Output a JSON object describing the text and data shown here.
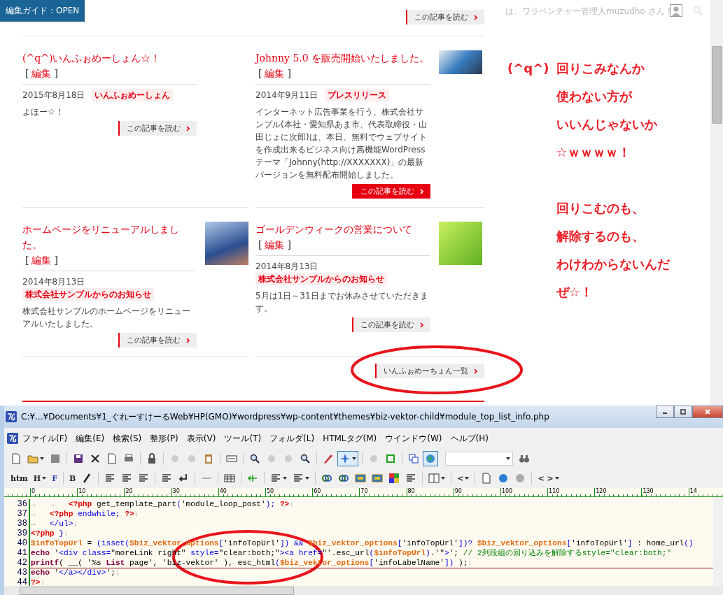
{
  "guide_tab": "編集ガイド：OPEN",
  "greeting": "は、ワラベンチャー管理人muzudho さん！",
  "top_read_more": {
    "label": "この記事を読む",
    "highlighted": false
  },
  "articles": [
    {
      "title": "(^q^)いんふぉめーしょん☆！",
      "edit": {
        "open": "[",
        "label": "編集",
        "close": "]"
      },
      "date": "2015年8月18日",
      "category": "いんふぉめーしょん",
      "excerpt": "よほー☆！",
      "read_more": {
        "label": "この記事を読む",
        "highlighted": false
      }
    },
    {
      "title": "Johnny 5.0 を販売開始いたしました。",
      "edit": {
        "open": "[",
        "label": "編集",
        "close": "]"
      },
      "date": "2014年9月11日",
      "category": "プレスリリース",
      "excerpt": "インターネット広告事業を行う、株式会社サンプル(本社・愛知県あま市、代表取締役・山田じょに次郎)は、本日、無料でウェブサイトを作成出来るビジネス向け高機能WordPressテーマ「Johnny(http://XXXXXXX)」の最新バージョンを無料配布開始しました。",
      "photo": {
        "kind": "laptop"
      },
      "read_more": {
        "label": "この記事を読む",
        "highlighted": true
      }
    },
    {
      "title": "ホームページをリニューアルしました。",
      "edit": {
        "open": "[",
        "label": "編集",
        "close": "]"
      },
      "date": "2014年8月13日",
      "category": "株式会社サンプルからのお知らせ",
      "excerpt": "株式会社サンプルのホームページをリニューアルいたしました。",
      "photo": {
        "kind": "hand"
      },
      "read_more": {
        "label": "この記事を読む",
        "highlighted": false
      }
    },
    {
      "title": "ゴールデンウィークの営業について",
      "edit": {
        "open": "[",
        "label": "編集",
        "close": "]"
      },
      "date": "2014年8月13日",
      "category": "株式会社サンプルからのお知らせ",
      "excerpt": "5月は1日～31日までお休みさせていただきます。",
      "photo": {
        "kind": "leaves"
      },
      "read_more": {
        "label": "この記事を読む",
        "highlighted": false
      }
    }
  ],
  "list_link": "いんふぉめーちょん一覧",
  "annotation": {
    "prefix": "(^q^)",
    "paragraphs": [
      [
        "回りこみなんか",
        "使わない方が",
        "いいんじゃないか",
        "☆ｗｗｗｗ！"
      ],
      [
        "回りこむのも、",
        "解除するのも、",
        "わけわからないんだ",
        "ぜ☆！"
      ]
    ]
  },
  "editor": {
    "title": "C:¥...¥Documents¥1_ぐれーすけーるWeb¥HP(GMO)¥wordpress¥wp-content¥themes¥biz-vektor-child¥module_top_list_info.php",
    "menu": [
      "ファイル(F)",
      "編集(E)",
      "検索(S)",
      "整形(P)",
      "表示(V)",
      "ツール(T)",
      "フォルダ(L)",
      "HTMLタグ(M)",
      "ウインドウ(W)",
      "ヘルプ(H)"
    ],
    "main_toolbar": [
      {
        "pressed": false
      },
      {
        "pressed": false
      },
      {
        "pressed": false
      },
      {
        "pressed": false
      },
      {
        "pressed": false
      },
      {
        "pressed": false
      },
      {
        "pressed": false
      },
      {
        "pressed": false
      },
      {
        "pressed": false
      },
      {
        "pressed": false
      },
      {
        "pressed": false
      },
      {
        "pressed": false
      },
      {
        "pressed": false
      },
      {
        "pressed": false
      },
      {
        "pressed": false
      },
      {
        "pressed": false
      },
      {
        "pressed": false
      },
      {
        "pressed": true
      },
      {
        "pressed": false
      },
      {
        "pressed": false
      },
      {
        "pressed": false
      },
      {
        "pressed": true
      }
    ],
    "format_labels": [
      "htm",
      "H",
      "F",
      "B",
      "<",
      "< >"
    ],
    "ruler": [
      "0",
      "10",
      "20",
      "30",
      "40",
      "50",
      "60",
      "70",
      "80",
      "90",
      "100",
      "110",
      "120",
      "130",
      "14"
    ],
    "lines": [
      {
        "number": "36",
        "current": false,
        "tokens": [
          {
            "kind": "tab",
            "text": "→   →   "
          },
          {
            "kind": "php",
            "text": "<?php"
          },
          {
            "kind": "plain",
            "text": " get_template_part"
          },
          {
            "kind": "kw",
            "text": "("
          },
          {
            "kind": "str",
            "text": "'module_loop_post'"
          },
          {
            "kind": "kw",
            "text": "); "
          },
          {
            "kind": "php",
            "text": "?>"
          },
          {
            "kind": "eol",
            "text": "↓"
          }
        ]
      },
      {
        "number": "37",
        "current": false,
        "tokens": [
          {
            "kind": "tab",
            "text": "→   "
          },
          {
            "kind": "php",
            "text": "<?php "
          },
          {
            "kind": "kw",
            "text": "endwhile; "
          },
          {
            "kind": "php",
            "text": "?>"
          },
          {
            "kind": "eol",
            "text": "↓"
          }
        ]
      },
      {
        "number": "38",
        "current": false,
        "tokens": [
          {
            "kind": "tab",
            "text": "→   "
          },
          {
            "kind": "kw",
            "text": "</ul>"
          },
          {
            "kind": "eol",
            "text": "↓"
          }
        ]
      },
      {
        "number": "39",
        "current": false,
        "tokens": [
          {
            "kind": "php",
            "text": "<?php "
          },
          {
            "kind": "kw",
            "text": "}"
          },
          {
            "kind": "eol",
            "text": "↓"
          }
        ]
      },
      {
        "number": "40",
        "current": false,
        "tokens": [
          {
            "kind": "var",
            "text": "$infoTopUrl"
          },
          {
            "kind": "plain",
            "text": " = "
          },
          {
            "kind": "kw",
            "text": "(isset("
          },
          {
            "kind": "var",
            "text": "$biz_vektor_options"
          },
          {
            "kind": "kw",
            "text": "["
          },
          {
            "kind": "str",
            "text": "'infoTopUrl'"
          },
          {
            "kind": "kw",
            "text": "]) && "
          },
          {
            "kind": "var",
            "text": "$biz_vektor_options"
          },
          {
            "kind": "kw",
            "text": "["
          },
          {
            "kind": "str",
            "text": "'infoTopUrl'"
          },
          {
            "kind": "kw",
            "text": "])? "
          },
          {
            "kind": "var",
            "text": "$biz_vektor_options"
          },
          {
            "kind": "kw",
            "text": "["
          },
          {
            "kind": "str",
            "text": "'infoTopUrl'"
          },
          {
            "kind": "kw",
            "text": "]"
          },
          {
            "kind": "plain",
            "text": " : home_url"
          },
          {
            "kind": "kw",
            "text": "()"
          }
        ]
      },
      {
        "number": "41",
        "current": false,
        "tokens": [
          {
            "kind": "fn",
            "text": "echo "
          },
          {
            "kind": "str",
            "text": "'"
          },
          {
            "kind": "kw",
            "text": "<div class="
          },
          {
            "kind": "str",
            "text": "\"moreLink right\""
          },
          {
            "kind": "kw",
            "text": " style="
          },
          {
            "kind": "str",
            "text": "\"clear:both;\""
          },
          {
            "kind": "kw",
            "text": "><a href="
          },
          {
            "kind": "str",
            "text": "\"'"
          },
          {
            "kind": "plain",
            "text": ".esc_url"
          },
          {
            "kind": "kw",
            "text": "("
          },
          {
            "kind": "var",
            "text": "$infoTopUrl"
          },
          {
            "kind": "kw",
            "text": ")"
          },
          {
            "kind": "plain",
            "text": "."
          },
          {
            "kind": "str",
            "text": "'\""
          },
          {
            "kind": "kw",
            "text": ">"
          },
          {
            "kind": "str",
            "text": "'"
          },
          {
            "kind": "plain",
            "text": "; "
          },
          {
            "kind": "cmt",
            "text": "// 2列段組の回り込みを解除するstyle=\"clear:both;\""
          }
        ]
      },
      {
        "number": "42",
        "current": true,
        "tokens": [
          {
            "kind": "fn",
            "text": "printf"
          },
          {
            "kind": "plain",
            "text": "( __( "
          },
          {
            "kind": "str",
            "text": "'%s "
          },
          {
            "kind": "fn",
            "text": "List"
          },
          {
            "kind": "str",
            "text": " page', 'biz-vektor'"
          },
          {
            "kind": "plain",
            "text": " ), esc_html"
          },
          {
            "kind": "kw",
            "text": "("
          },
          {
            "kind": "var",
            "text": "$biz_vektor_options"
          },
          {
            "kind": "kw",
            "text": "["
          },
          {
            "kind": "str",
            "text": "'infoLabelName'"
          },
          {
            "kind": "kw",
            "text": "])"
          },
          {
            "kind": "plain",
            "text": " );"
          },
          {
            "kind": "eol",
            "text": "↓"
          }
        ]
      },
      {
        "number": "43",
        "current": false,
        "tokens": [
          {
            "kind": "fn",
            "text": "echo "
          },
          {
            "kind": "str",
            "text": "'"
          },
          {
            "kind": "kw",
            "text": "</a></div>"
          },
          {
            "kind": "str",
            "text": "'"
          },
          {
            "kind": "plain",
            "text": ";"
          },
          {
            "kind": "eol",
            "text": "↓"
          }
        ]
      },
      {
        "number": "44",
        "current": false,
        "tokens": [
          {
            "kind": "php",
            "text": "?>"
          },
          {
            "kind": "eol",
            "text": "↓"
          }
        ]
      }
    ]
  }
}
